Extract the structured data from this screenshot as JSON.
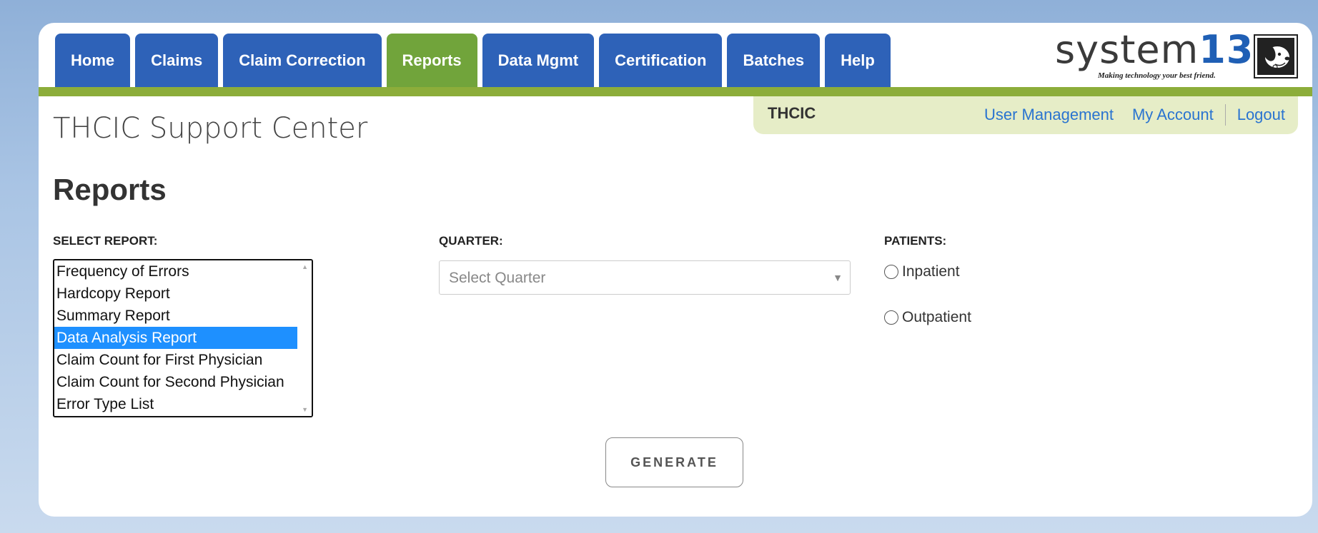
{
  "nav": {
    "tabs": [
      {
        "label": "Home"
      },
      {
        "label": "Claims"
      },
      {
        "label": "Claim Correction"
      },
      {
        "label": "Reports"
      },
      {
        "label": "Data Mgmt"
      },
      {
        "label": "Certification"
      },
      {
        "label": "Batches"
      },
      {
        "label": "Help"
      }
    ],
    "active_tab": "Reports"
  },
  "logo": {
    "text_prefix": "system",
    "text_number": "13",
    "tagline": "Making technology your best friend."
  },
  "userbar": {
    "org": "THCIC",
    "links": {
      "user_management": "User Management",
      "my_account": "My Account",
      "logout": "Logout"
    }
  },
  "header": {
    "site_title": "THCIC Support Center",
    "page_title": "Reports"
  },
  "form": {
    "select_report_label": "SELECT REPORT:",
    "reports": [
      "Frequency of Errors",
      "Hardcopy Report",
      "Summary Report",
      "Data Analysis Report",
      "Claim Count for First Physician",
      "Claim Count for Second Physician",
      "Error Type List"
    ],
    "selected_report": "Data Analysis Report",
    "quarter_label": "QUARTER:",
    "quarter_placeholder": "Select Quarter",
    "patients_label": "PATIENTS:",
    "patient_options": [
      "Inpatient",
      "Outpatient"
    ],
    "generate_label": "GENERATE"
  },
  "colors": {
    "tab_blue": "#2e62b8",
    "tab_active_green": "#71a43b",
    "accent_bar": "#8cad3a",
    "link_blue": "#2a74d0",
    "selection_blue": "#1e90ff"
  }
}
